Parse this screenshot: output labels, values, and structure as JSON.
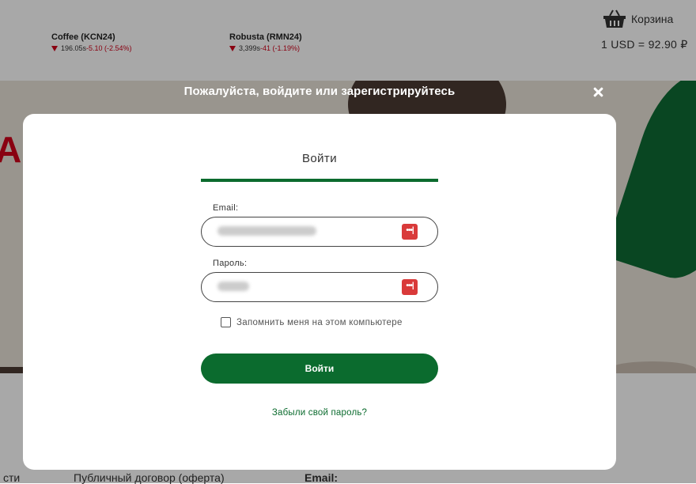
{
  "header": {
    "tickers": [
      {
        "name": "Coffee (KCN24)",
        "price": "196.05s",
        "change": "-5.10 (-2.54%)"
      },
      {
        "name": "Robusta (RMN24)",
        "price": "3,399s",
        "change": "-41 (-1.19%)"
      }
    ],
    "cart_label": "Корзина",
    "rate": "1 USD = 92.90 ₽"
  },
  "hero": {
    "letter": "А"
  },
  "footer": {
    "col1": "сти",
    "col2": "Публичный договор (оферта)",
    "col3": "Email:"
  },
  "modal": {
    "title": "Пожалуйста, войдите или зарегистрируйтесь",
    "tab_label": "Войти",
    "email_label": "Email:",
    "password_label": "Пароль:",
    "remember_label": "Запомнить меня на этом компьютере",
    "login_button": "Войти",
    "forgot_link": "Забыли свой пароль?",
    "password_manager_icon": "•••|"
  },
  "colors": {
    "brand_green": "#0b6b2e",
    "negative": "#d0021b",
    "pm_icon": "#d93a3a"
  }
}
